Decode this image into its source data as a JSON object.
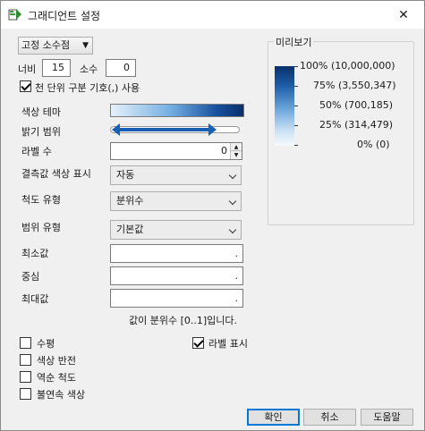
{
  "window": {
    "title": "그래디언트 설정",
    "close_glyph": "✕"
  },
  "format": {
    "selected": "고정 소수점"
  },
  "width": {
    "label": "너비",
    "value": "15"
  },
  "decimal": {
    "label": "소수",
    "value": "0"
  },
  "thousands": {
    "label": "천 단위 구분 기호(,) 사용",
    "checked": true
  },
  "theme": {
    "label": "색상 테마"
  },
  "brightness": {
    "label": "밝기 범위"
  },
  "label_count": {
    "label": "라벨 수",
    "value": "0"
  },
  "missing": {
    "label": "결측값 색상 표시",
    "selected": "자동"
  },
  "scale_type": {
    "label": "척도 유형",
    "selected": "분위수"
  },
  "range_type": {
    "label": "범위 유형",
    "selected": "기본값"
  },
  "min": {
    "label": "최소값",
    "value": "."
  },
  "center": {
    "label": "중심",
    "value": "."
  },
  "max": {
    "label": "최대값",
    "value": "."
  },
  "quantile_note": "값이 분위수 [0..1]입니다.",
  "checkboxes": {
    "horizontal": {
      "label": "수평",
      "checked": false
    },
    "reverse_color": {
      "label": "색상 반전",
      "checked": false
    },
    "reverse_scale": {
      "label": "역순 척도",
      "checked": false
    },
    "discrete": {
      "label": "불연속 색상",
      "checked": false
    },
    "show_labels": {
      "label": "라벨 표시",
      "checked": true
    }
  },
  "preview": {
    "title": "미리보기",
    "labels": [
      "100% (10,000,000)",
      "75% (3,550,347)",
      "50% (700,185)",
      "25% (314,479)",
      "0% (0)"
    ]
  },
  "buttons": {
    "ok": "확인",
    "cancel": "취소",
    "help": "도움말"
  },
  "colors": {
    "accent": "#1b5fb5",
    "gradient_dark": "#08306b",
    "gradient_light": "#f7fbff"
  }
}
